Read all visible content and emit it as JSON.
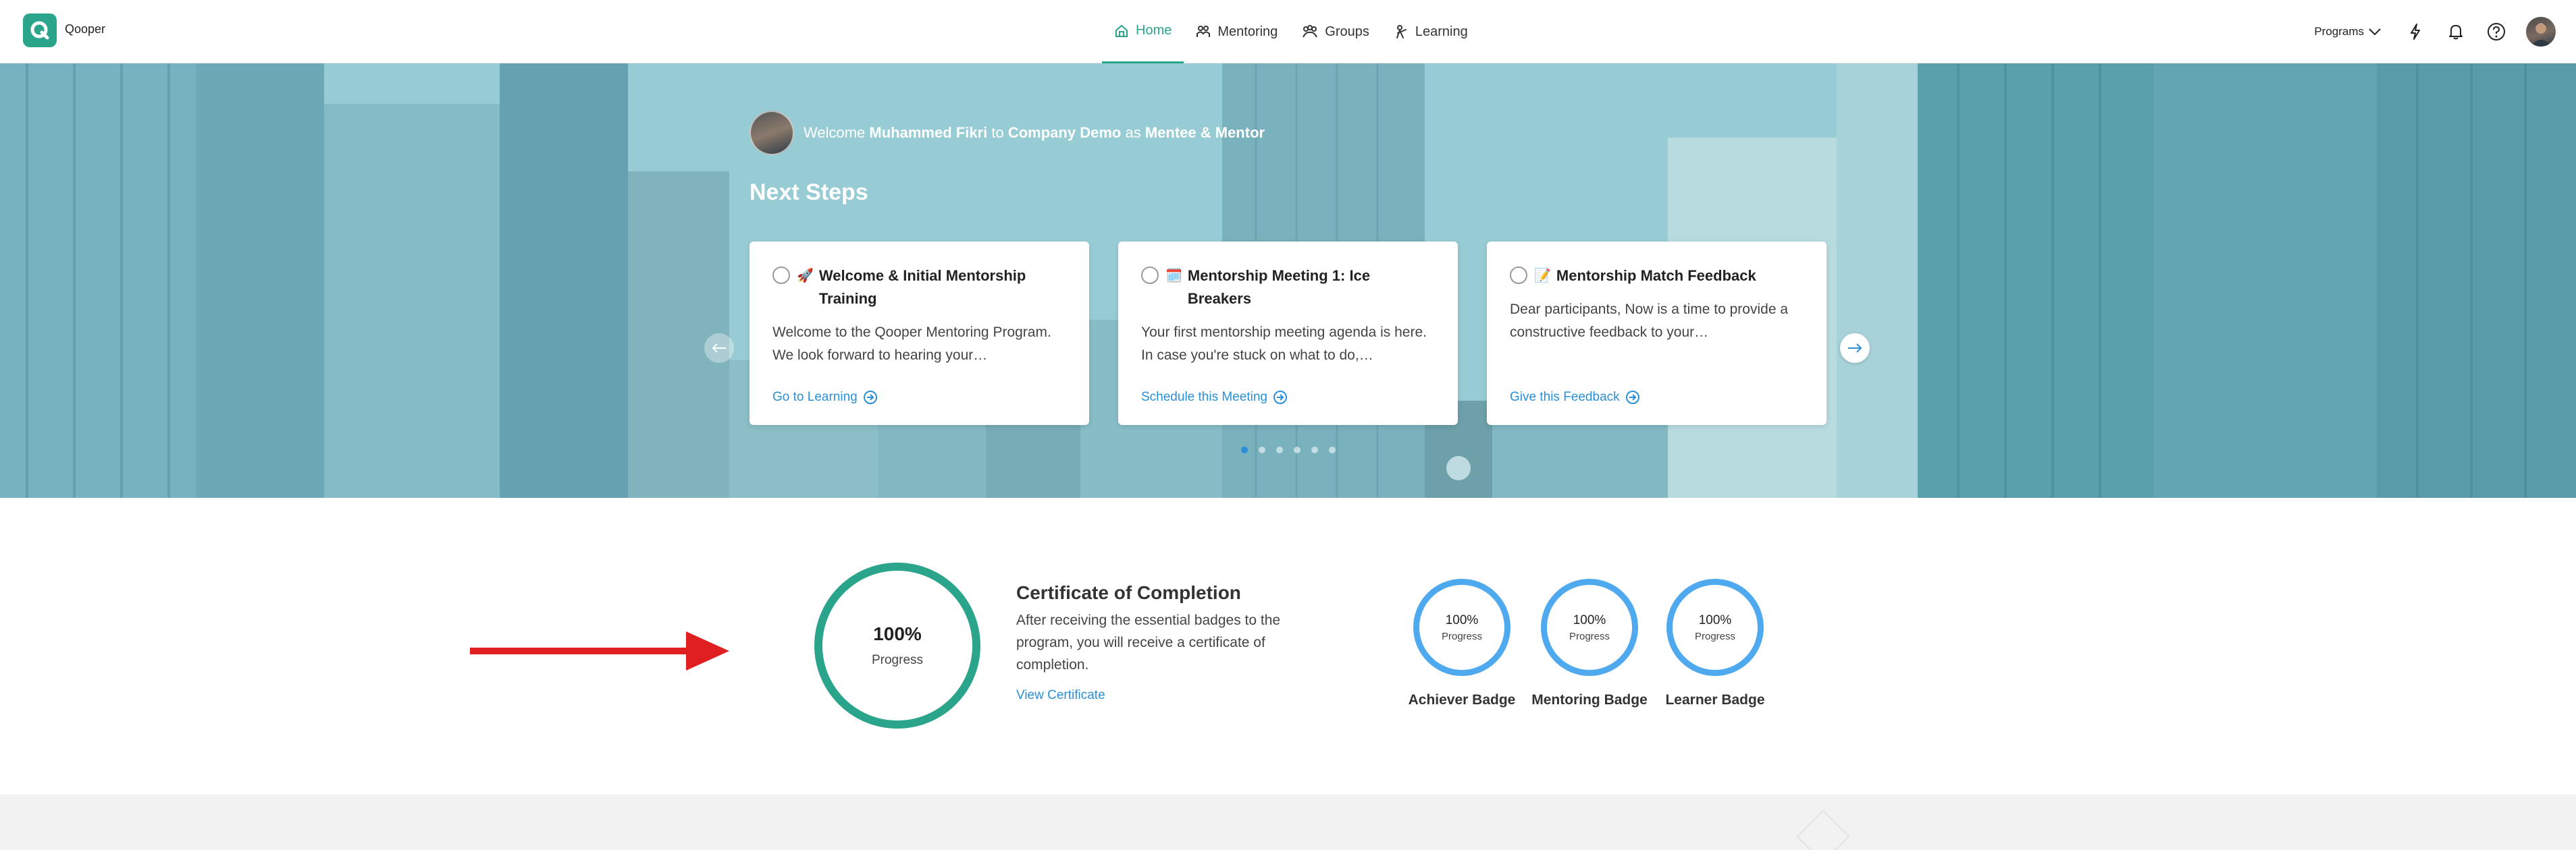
{
  "app": {
    "name": "Qooper"
  },
  "nav": {
    "items": [
      {
        "label": "Home",
        "icon": "home-icon",
        "active": true
      },
      {
        "label": "Mentoring",
        "icon": "mentoring-icon",
        "active": false
      },
      {
        "label": "Groups",
        "icon": "groups-icon",
        "active": false
      },
      {
        "label": "Learning",
        "icon": "learning-icon",
        "active": false
      }
    ],
    "programs_label": "Programs"
  },
  "hero": {
    "welcome_prefix": "Welcome",
    "user_name": "Muhammed Fikri",
    "to_text": "to",
    "company": "Company Demo",
    "as_text": "as",
    "role": "Mentee & Mentor",
    "next_steps_title": "Next Steps",
    "cards": [
      {
        "emoji": "🚀",
        "title": "Welcome & Initial Mentorship Training",
        "body": "Welcome to the Qooper Mentoring Program. We look forward to hearing your…",
        "link": "Go to Learning"
      },
      {
        "emoji": "🗓️",
        "title": "Mentorship Meeting 1: Ice Breakers",
        "body": "Your first mentorship meeting agenda is here. In case you're stuck on what to do,…",
        "link": "Schedule this Meeting"
      },
      {
        "emoji": "📝",
        "title": "Mentorship Match Feedback",
        "body": "Dear participants, Now is a time to provide a constructive feedback to your…",
        "link": "Give this Feedback"
      }
    ],
    "carousel_pages": 6,
    "carousel_active": 0
  },
  "progress": {
    "overall_pct": "100%",
    "overall_label": "Progress",
    "certificate_title": "Certificate of Completion",
    "certificate_desc": "After receiving the essential badges to the program, you will receive a certificate of completion.",
    "certificate_link": "View Certificate",
    "badges": [
      {
        "pct": "100%",
        "label": "Progress",
        "name": "Achiever Badge"
      },
      {
        "pct": "100%",
        "label": "Progress",
        "name": "Mentoring Badge"
      },
      {
        "pct": "100%",
        "label": "Progress",
        "name": "Learner Badge"
      }
    ]
  },
  "colors": {
    "brand": "#2aa58c",
    "link": "#2a8fd6",
    "badge_ring": "#4fa9ef",
    "annotation_arrow": "#e02020"
  }
}
